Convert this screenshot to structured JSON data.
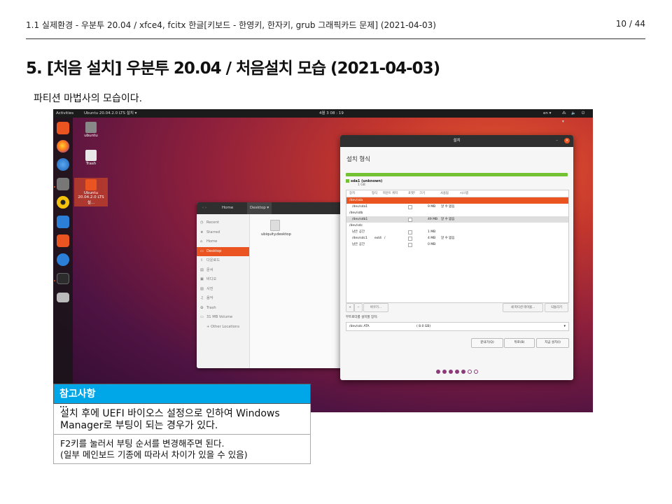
{
  "header": {
    "breadcrumb": "1.1 실제환경 - 우분투 20.04 / xfce4, fcitx 한글[키보드 - 한영키, 한자키, grub 그래픽카드 문제] (2021-04-03)",
    "page_number": "10 / 44"
  },
  "title": "5. [처음 설치] 우분투 20.04 / 처음설치 모습 (2021-04-03)",
  "intro": "파티션 마법사의 모습이다.",
  "screenshot": {
    "topbar": {
      "activities": "Activities",
      "app_menu": "Ubuntu 20.04.2.0 LTS 설치 ▾",
      "clock": "4월 3 08 : 19",
      "lang": "en ▾",
      "tray": "⁂ 🔈 ⏻ ▾"
    },
    "desktop_icons": [
      {
        "label": "ubuntu"
      },
      {
        "label": "Trash"
      },
      {
        "label": "Ubuntu 20.04.2.0 LTS 설..."
      }
    ],
    "files_window": {
      "path_home": "Home",
      "path_current": "Desktop ▾",
      "sidebar": [
        "Recent",
        "Starred",
        "Home",
        "Desktop",
        "다운로드",
        "문서",
        "비디오",
        "사진",
        "음악",
        "Trash",
        "31 MB Volume",
        "+ Other Locations"
      ],
      "file_label": "ubiquity.desktop"
    },
    "installer": {
      "window_title": "설치",
      "heading": "설치 형식",
      "partition_name": "sda1 (unknown)",
      "partition_size": "1 GB",
      "columns": [
        "장치",
        "형식",
        "마운트 위치",
        "포맷?",
        "크기",
        "사용됨",
        "시스템"
      ],
      "rows": [
        {
          "device": "/dev/sda",
          "type": "",
          "mount": "",
          "size": "",
          "used": "",
          "sel": true
        },
        {
          "device": "/dev/sda1",
          "type": "",
          "mount": "",
          "size": "9 MB",
          "used": "알 수 없음"
        },
        {
          "device": "/dev/sdb",
          "type": "",
          "mount": "",
          "size": "",
          "used": ""
        },
        {
          "device": "/dev/sdb1",
          "type": "",
          "mount": "",
          "size": "49 MB",
          "used": "알 수 없음"
        },
        {
          "device": "/dev/sdc",
          "type": "",
          "mount": "",
          "size": "",
          "used": ""
        },
        {
          "device": "남은 공간",
          "type": "",
          "mount": "",
          "size": "1 MB",
          "used": ""
        },
        {
          "device": "/dev/sdc1",
          "type": "ext4",
          "mount": "/",
          "size": "4 MB",
          "used": "알 수 없음"
        },
        {
          "device": "남은 공간",
          "type": "",
          "mount": "",
          "size": "0 MB",
          "used": ""
        }
      ],
      "btn_add": "+",
      "btn_remove": "−",
      "btn_change": "바꾸기...",
      "btn_new_table": "새 파티션 테이블...",
      "btn_revert": "되돌리기",
      "boot_label": "부트로더를 설치할 장치:",
      "boot_device": "/dev/sdc  ATA",
      "boot_size": "(  8.0 GB)",
      "btn_quit": "끝내기(Q)",
      "btn_back": "뒤로(B)",
      "btn_install": "지금 설치(I)",
      "progress_total": 7,
      "progress_done": 5
    }
  },
  "note": {
    "title": "참고사항",
    "ellipsis": "...",
    "items": [
      "설치 후에 UEFI 바이오스 설정으로 인하여 Windows Manager로 부팅이 되는 경우가 있다.",
      "F2키를 눌러서 부팅 순서를 변경해주면 된다.\n(일부 메인보드 기종에 따라서 차이가 있을 수 있음)"
    ]
  },
  "colors": {
    "ubuntu_orange": "#e95420",
    "note_header": "#00a7e8",
    "partition_green": "#73c234",
    "progress_dot": "#8c3b7a"
  }
}
